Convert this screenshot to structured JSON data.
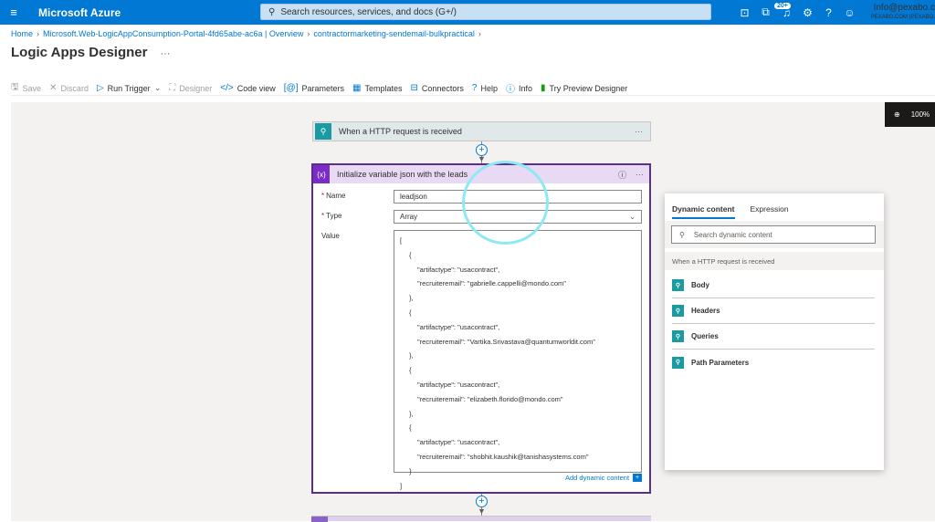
{
  "topbar": {
    "menu_icon": "hamburger-icon",
    "brand": "Microsoft Azure",
    "search_placeholder": "Search resources, services, and docs (G+/)",
    "notification_count": "20+",
    "account_email": "Info@pexabo.c",
    "account_org": "PEXABO.COM (PEXABO."
  },
  "breadcrumb": {
    "items": [
      "Home",
      "Microsoft.Web-LogicAppConsumption-Portal-4fd65abe-ac6a | Overview",
      "contractormarketing-sendemail-bulkpractical"
    ]
  },
  "page": {
    "title": "Logic Apps Designer",
    "more": "···"
  },
  "toolbar": {
    "save": "Save",
    "discard": "Discard",
    "run_trigger": "Run Trigger",
    "designer": "Designer",
    "code_view": "Code view",
    "parameters": "Parameters",
    "templates": "Templates",
    "connectors": "Connectors",
    "help": "Help",
    "info": "Info",
    "try_preview": "Try Preview Designer"
  },
  "zoom": {
    "level": "100%"
  },
  "trigger": {
    "title": "When a HTTP request is received",
    "more": "···"
  },
  "action": {
    "icon_label": "{x}",
    "title": "Initialize variable json with the leads",
    "name_label": "Name",
    "name_value": "leadjson",
    "type_label": "Type",
    "type_value": "Array",
    "value_label": "Value",
    "value_lines": [
      "[",
      "{",
      "\"artifactype\": \"usacontract\",",
      "\"recruiteremail\": \"gabrielle.cappelli@mondo.com\"",
      "},",
      "{",
      "\"artifactype\": \"usacontract\",",
      "\"recruiteremail\": \"Vartika.Srivastava@quantumworldit.com\"",
      "},",
      "{",
      "\"artifactype\": \"usacontract\",",
      "\"recruiteremail\": \"elizabeth.florido@mondo.com\"",
      "},",
      "{",
      "\"artifactype\": \"usacontract\",",
      "\"recruiteremail\": \"shobhit.kaushik@tanishasystems.com\"",
      "}",
      "]"
    ],
    "add_dynamic": "Add dynamic content"
  },
  "dynamic_panel": {
    "tab_dynamic": "Dynamic content",
    "tab_expression": "Expression",
    "search_placeholder": "Search dynamic content",
    "group": "When a HTTP request is received",
    "items": [
      "Body",
      "Headers",
      "Queries",
      "Path Parameters"
    ]
  },
  "colors": {
    "accent": "#0078d4",
    "variable_purple": "#5c2d91",
    "trigger_teal": "#1a9ba1",
    "annotation_circle": "#8ee9f2"
  }
}
